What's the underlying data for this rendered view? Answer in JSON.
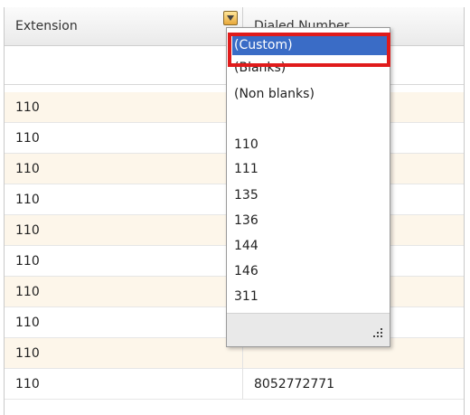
{
  "header": {
    "columns": [
      "Extension",
      "Dialed Number"
    ]
  },
  "rows": [
    {
      "extension": "110",
      "dialed": ""
    },
    {
      "extension": "110",
      "dialed": ""
    },
    {
      "extension": "110",
      "dialed": ""
    },
    {
      "extension": "110",
      "dialed": ""
    },
    {
      "extension": "110",
      "dialed": ""
    },
    {
      "extension": "110",
      "dialed": ""
    },
    {
      "extension": "110",
      "dialed": ""
    },
    {
      "extension": "110",
      "dialed": ""
    },
    {
      "extension": "110",
      "dialed": ""
    },
    {
      "extension": "110",
      "dialed": "8052772771"
    }
  ],
  "filter_popup": {
    "items": [
      "(Custom)",
      "(Blanks)",
      "(Non blanks)",
      "",
      "110",
      "111",
      "135",
      "136",
      "144",
      "146",
      "311"
    ],
    "selected_index": 0
  },
  "colors": {
    "row_alt": "#fdf6ea",
    "selection": "#3a6cc6",
    "highlight_border": "#e01b1b"
  }
}
